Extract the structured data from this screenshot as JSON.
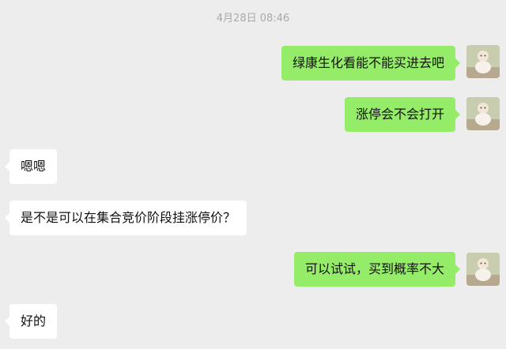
{
  "chat": {
    "timestamp": "4月28日 08:46",
    "messages": [
      {
        "direction": "outgoing",
        "text": "绿康生化看能不能买进去吧"
      },
      {
        "direction": "outgoing",
        "text": "涨停会不会打开"
      },
      {
        "direction": "incoming",
        "text": "嗯嗯"
      },
      {
        "direction": "incoming",
        "text": "是不是可以在集合竞价阶段挂涨停价？"
      },
      {
        "direction": "outgoing",
        "text": "可以试试，买到概率不大"
      },
      {
        "direction": "incoming",
        "text": "好的"
      }
    ]
  },
  "colors": {
    "background": "#ededed",
    "outgoing_bubble": "#95ec69",
    "incoming_bubble": "#ffffff",
    "timestamp_text": "#a9a9a9"
  },
  "icons": {
    "sender_avatar": "user-avatar-icon"
  }
}
